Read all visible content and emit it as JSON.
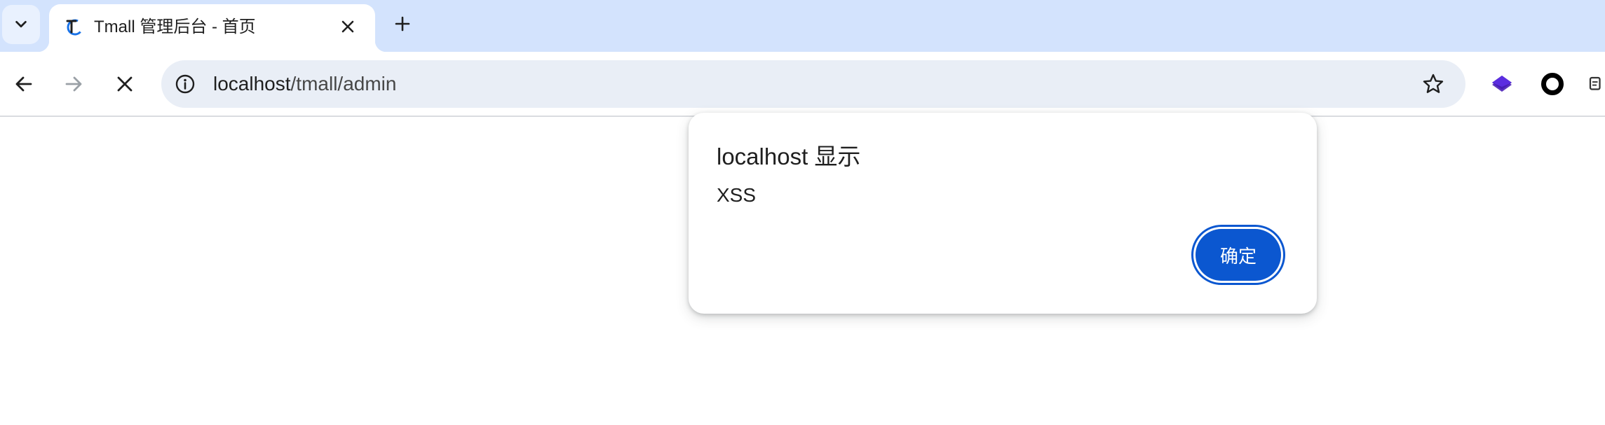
{
  "browser": {
    "tab": {
      "title": "Tmall 管理后台 - 首页",
      "favicon": "tmall-t-logo-icon"
    },
    "tab_search_icon": "chevron-down-icon",
    "new_tab_icon": "plus-icon",
    "nav": {
      "back_icon": "arrow-back-icon",
      "forward_icon": "arrow-forward-icon",
      "stop_icon": "close-icon"
    },
    "address_bar": {
      "host": "localhost",
      "path": "/tmall/admin",
      "site_info_icon": "info-icon",
      "bookmark_icon": "star-outline-icon"
    },
    "extensions": [
      "layers-extension-icon",
      "ring-extension-icon",
      "partial-extension-icon"
    ]
  },
  "dialog": {
    "title": "localhost 显示",
    "message": "XSS",
    "ok_label": "确定"
  },
  "colors": {
    "tabstrip_bg": "#d3e3fd",
    "omnibox_bg": "#e9eef6",
    "primary_button": "#0b57d0",
    "extension_purple": "#4a1fb8"
  }
}
